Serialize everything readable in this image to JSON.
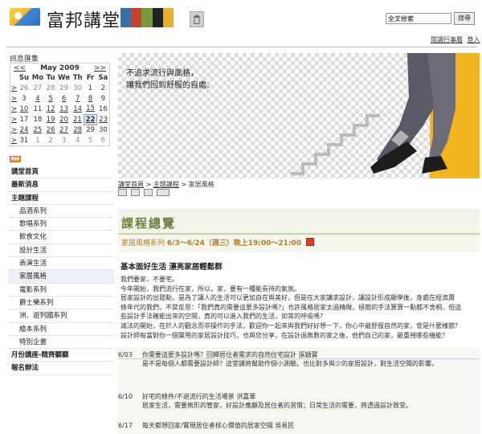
{
  "header": {
    "brand": "富邦講堂",
    "search_placeholder": "全文檢索",
    "search_button": "搜尋",
    "links": [
      "閱讀行事曆",
      "登入"
    ],
    "brand_art_colors": [
      "#3a6ea5",
      "#c8402f",
      "#7a9a3a",
      "#222222",
      "#e8b02a"
    ]
  },
  "sidebar": {
    "title": "訊息匯集",
    "calendar": {
      "prev": "<<",
      "month": "May 2009",
      "next": ">>",
      "weekdays": [
        " ",
        "Su",
        "Mo",
        "Tu",
        "We",
        "Th",
        "Fr",
        "Sa"
      ],
      "weeks": [
        [
          ">",
          "26",
          "27",
          "28",
          "29",
          "30",
          "1",
          "2"
        ],
        [
          ">",
          "3",
          "4",
          "5",
          "6",
          "7",
          "8",
          "9"
        ],
        [
          ">",
          "10",
          "11",
          "12",
          "13",
          "14",
          "15",
          "16"
        ],
        [
          ">",
          "17",
          "18",
          "19",
          "20",
          "21",
          "22",
          "23"
        ],
        [
          ">",
          "24",
          "25",
          "26",
          "27",
          "28",
          "29",
          "30"
        ],
        [
          ">",
          "31",
          "1",
          "2",
          "3",
          "4",
          "5",
          "6"
        ]
      ],
      "today": "22"
    },
    "menu": [
      {
        "label": "講堂首頁",
        "sub": false
      },
      {
        "label": "最新消息",
        "sub": false
      },
      {
        "label": "主題課程",
        "sub": false
      },
      {
        "label": "品酒系列",
        "sub": true
      },
      {
        "label": "歌唱系列",
        "sub": true
      },
      {
        "label": "飲食文化",
        "sub": true
      },
      {
        "label": "設計生活",
        "sub": true
      },
      {
        "label": "表演生活",
        "sub": true
      },
      {
        "label": "家居風格",
        "sub": true,
        "active": true
      },
      {
        "label": "電影系列",
        "sub": true
      },
      {
        "label": "爵士樂系列",
        "sub": true
      },
      {
        "label": "洲．遊列國系列",
        "sub": true
      },
      {
        "label": "繪本系列",
        "sub": true
      },
      {
        "label": "特別企畫",
        "sub": true
      },
      {
        "label": "月份講座-精齊聽聽",
        "sub": false
      },
      {
        "label": "報名辦法",
        "sub": false
      }
    ]
  },
  "banner": {
    "quote_line1": "不追求流行與風格，",
    "quote_line2": "讓我們回到舒服的自處。"
  },
  "breadcrumb": {
    "home": "講堂首頁",
    "section": "主題課程",
    "current": "家居風格",
    "sep": " > "
  },
  "course": {
    "title": "課程總覽",
    "series": "家居風格系列",
    "dates": "6/3～6/24（週三）晚上19:00～21:00",
    "subhead": "基本面好生活 漂亮家居輕鬆群",
    "paragraphs": [
      "我們要家，不要宅。",
      "今年開始，我們流行在家，所以，家，要有一種能長待的氣氛。",
      "居家設計的出發點，是為了讓人的生活可以更加自在與美好，但是在大家講求設計，讓設計形成顯學後，身處在經濟蕭",
      "條年代的我們，不禁反思：「我們真的需要這麼多設計嗎?」也許風格居家太過精緻，極簡的手法算算一點都不舍桐，但這",
      "些設計手法確能出來的空間，真的可以進入我們的生活，如常的呼吸嗎?",
      "滅法的開始，在於人的觀念而非操作的手法，歡迎你一起來與我們好好想一下，你心中最舒服自然的家，會是什麼樣貌？",
      "設計師每當對你一個實用的家居設計技巧，也與您分享，在設計過無數的家之後，他們自己的家，最重視哪些機能？"
    ]
  },
  "schedule": [
    {
      "date": "6/03",
      "title": "你需要這麼多設計嗎？回歸居住者需求的自然住宅設計 張穎寶",
      "desc": "是不是每個人都需要設計師？這堂課將幫助作個小測驗。也比對多與少的家居設計，對生活空間的影響。"
    },
    {
      "date": "6/10",
      "title": "好宅的條件/不退流行的生活場景 洪嘉華",
      "desc": "居家生活，需要無形的管家，好設計應顧及居住者的習慣；日常生活的需要，將透過設計致受。"
    },
    {
      "date": "6/17",
      "title": "每天都想回家/實現居住者核心價值的居家空間 吳易民",
      "desc": ""
    }
  ]
}
